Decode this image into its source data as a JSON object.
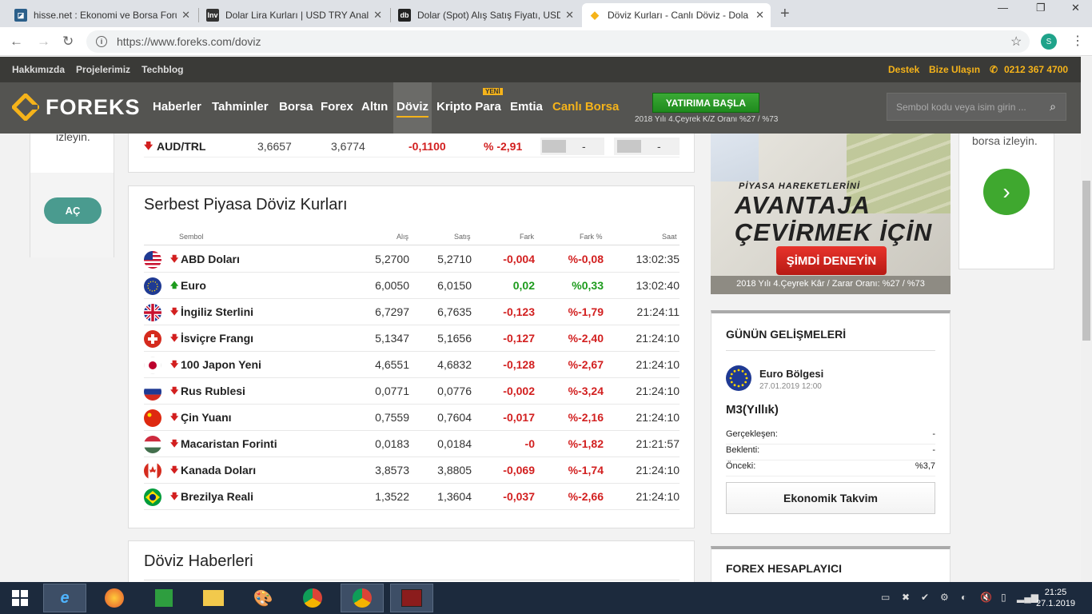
{
  "browser": {
    "tabs": [
      {
        "title": "hisse.net : Ekonomi ve Borsa Foru",
        "icon": "hisse-net-icon",
        "fav": "h"
      },
      {
        "title": "Dolar Lira Kurları | USD TRY Anal",
        "icon": "investing-icon",
        "fav": "inv"
      },
      {
        "title": "Dolar (Spot) Alış Satış Fiyatı, USD",
        "icon": "doviz-db-icon",
        "fav": "db"
      },
      {
        "title": "Döviz Kurları - Canlı Döviz - Dola",
        "icon": "foreks-icon",
        "fav": "◆"
      }
    ],
    "url": "https://www.foreks.com/doviz",
    "profile_initial": "S"
  },
  "topstrip": {
    "left": [
      "Hakkımızda",
      "Projelerimiz",
      "Techblog"
    ],
    "right": [
      "Destek",
      "Bize Ulaşın",
      "0212 367 4700"
    ]
  },
  "nav": {
    "logo": "FOREKS",
    "items": [
      "Haberler",
      "Tahminler",
      "Borsa",
      "Forex",
      "Altın",
      "Döviz",
      "Kripto Para",
      "Emtia",
      "Canlı Borsa"
    ],
    "new_badge": "YENİ",
    "cta": "YATIRIMA BAŞLA",
    "cta_note": "2018 Yılı 4.Çeyrek K/Z Oranı %27 / %73",
    "search_placeholder": "Sembol kodu veya isim girin ..."
  },
  "left_ad": {
    "text": "izleyin.",
    "button": "AÇ"
  },
  "aud_row": {
    "name": "AUD/TRL",
    "buy": "3,6657",
    "sell": "3,6774",
    "diff": "-0,1100",
    "pct": "% -2,91",
    "d1": "-",
    "d2": "-"
  },
  "free_market": {
    "title": "Serbest Piyasa Döviz Kurları",
    "headers": [
      "Sembol",
      "Alış",
      "Satış",
      "Fark",
      "Fark %",
      "Saat"
    ],
    "rows": [
      {
        "name": "ABD Doları",
        "flag": "us-flag",
        "buy": "5,2700",
        "sell": "5,2710",
        "diff": "-0,004",
        "pct": "%-0,08",
        "time": "13:02:35",
        "dir": "down"
      },
      {
        "name": "Euro",
        "flag": "eu-flag",
        "buy": "6,0050",
        "sell": "6,0150",
        "diff": "0,02",
        "pct": "%0,33",
        "time": "13:02:40",
        "dir": "up"
      },
      {
        "name": "İngiliz Sterlini",
        "flag": "uk-flag",
        "buy": "6,7297",
        "sell": "6,7635",
        "diff": "-0,123",
        "pct": "%-1,79",
        "time": "21:24:11",
        "dir": "down"
      },
      {
        "name": "İsviçre Frangı",
        "flag": "ch-flag",
        "buy": "5,1347",
        "sell": "5,1656",
        "diff": "-0,127",
        "pct": "%-2,40",
        "time": "21:24:10",
        "dir": "down"
      },
      {
        "name": "100 Japon Yeni",
        "flag": "jp-flag",
        "buy": "4,6551",
        "sell": "4,6832",
        "diff": "-0,128",
        "pct": "%-2,67",
        "time": "21:24:10",
        "dir": "down"
      },
      {
        "name": "Rus Rublesi",
        "flag": "ru-flag",
        "buy": "0,0771",
        "sell": "0,0776",
        "diff": "-0,002",
        "pct": "%-3,24",
        "time": "21:24:10",
        "dir": "down"
      },
      {
        "name": "Çin Yuanı",
        "flag": "cn-flag",
        "buy": "0,7559",
        "sell": "0,7604",
        "diff": "-0,017",
        "pct": "%-2,16",
        "time": "21:24:10",
        "dir": "down"
      },
      {
        "name": "Macaristan Forinti",
        "flag": "hu-flag",
        "buy": "0,0183",
        "sell": "0,0184",
        "diff": "-0",
        "pct": "%-1,82",
        "time": "21:21:57",
        "dir": "down"
      },
      {
        "name": "Kanada Doları",
        "flag": "ca-flag",
        "buy": "3,8573",
        "sell": "3,8805",
        "diff": "-0,069",
        "pct": "%-1,74",
        "time": "21:24:10",
        "dir": "down"
      },
      {
        "name": "Brezilya Reali",
        "flag": "br-flag",
        "buy": "1,3522",
        "sell": "1,3604",
        "diff": "-0,037",
        "pct": "%-2,66",
        "time": "21:24:10",
        "dir": "down"
      }
    ]
  },
  "news": {
    "title": "Döviz Haberleri"
  },
  "banner": {
    "line1": "PİYASA HAREKETLERİNİ",
    "line2": "AVANTAJA",
    "line3": "ÇEVİRMEK İÇİN",
    "button": "ŞİMDİ DENEYİN",
    "note": "2018 Yılı 4.Çeyrek Kâr / Zarar Oranı: %27 / %73"
  },
  "events": {
    "title": "GÜNÜN GELİŞMELERİ",
    "region": "Euro Bölgesi",
    "date": "27.01.2019  12:00",
    "indicator": "M3(Yıllık)",
    "fields": [
      {
        "k": "Gerçekleşen:",
        "v": "-"
      },
      {
        "k": "Beklenti:",
        "v": "-"
      },
      {
        "k": "Önceki:",
        "v": "%3,7"
      }
    ],
    "button": "Ekonomik Takvim"
  },
  "calc": {
    "title": "FOREX HESAPLAYICI"
  },
  "right_ad": {
    "text": "borsa izleyin."
  },
  "taskbar": {
    "time": "21:25",
    "date": "27.1.2019"
  },
  "colors": {
    "accent": "#f5b31a",
    "negative": "#d21f1f",
    "positive": "#1d9b1d",
    "nav": "#545451"
  }
}
